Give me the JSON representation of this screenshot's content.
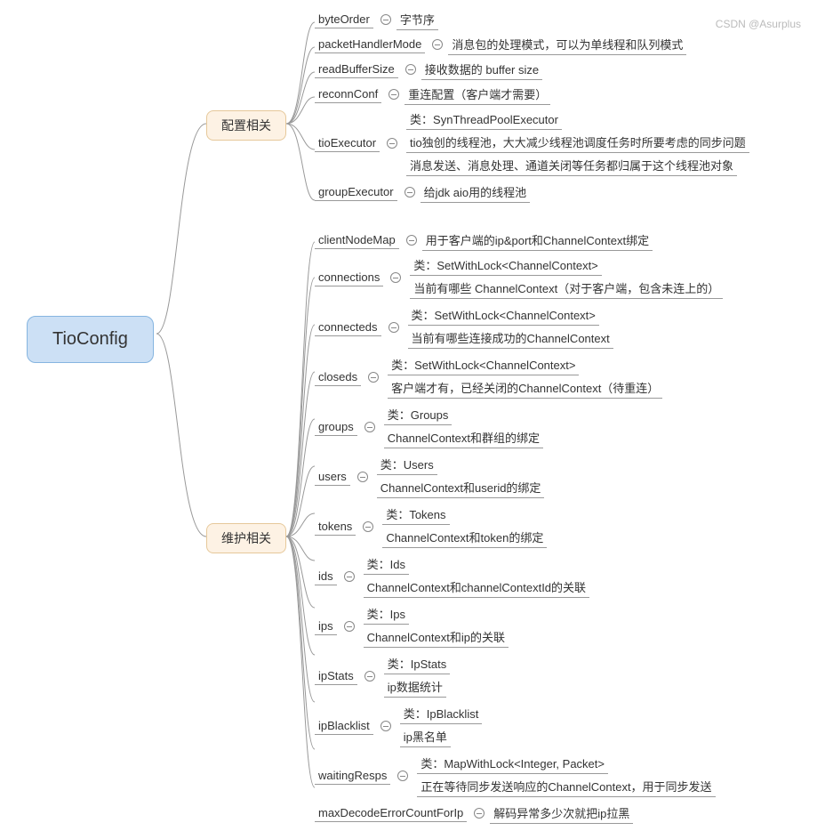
{
  "root": "TioConfig",
  "branches": [
    {
      "label": "配置相关"
    },
    {
      "label": "维护相关"
    }
  ],
  "config": {
    "byteOrder": {
      "name": "byteOrder",
      "desc": "字节序"
    },
    "packetHandlerMode": {
      "name": "packetHandlerMode",
      "desc": "消息包的处理模式，可以为单线程和队列模式"
    },
    "readBufferSize": {
      "name": "readBufferSize",
      "desc": "接收数据的 buffer size"
    },
    "reconnConf": {
      "name": "reconnConf",
      "desc": "重连配置（客户端才需要）"
    },
    "tioExecutor": {
      "name": "tioExecutor",
      "items": [
        "类：SynThreadPoolExecutor",
        "tio独创的线程池，大大减少线程池调度任务时所要考虑的同步问题",
        "消息发送、消息处理、通道关闭等任务都归属于这个线程池对象"
      ]
    },
    "groupExecutor": {
      "name": "groupExecutor",
      "desc": "给jdk aio用的线程池"
    }
  },
  "maintain": {
    "clientNodeMap": {
      "name": "clientNodeMap",
      "desc": "用于客户端的ip&port和ChannelContext绑定"
    },
    "connections": {
      "name": "connections",
      "items": [
        "类：SetWithLock<ChannelContext>",
        "当前有哪些 ChannelContext（对于客户端，包含未连上的）"
      ]
    },
    "connecteds": {
      "name": "connecteds",
      "items": [
        "类：SetWithLock<ChannelContext>",
        "当前有哪些连接成功的ChannelContext"
      ]
    },
    "closeds": {
      "name": "closeds",
      "items": [
        "类：SetWithLock<ChannelContext>",
        "客户端才有，已经关闭的ChannelContext（待重连）"
      ]
    },
    "groups": {
      "name": "groups",
      "items": [
        "类：Groups",
        "ChannelContext和群组的绑定"
      ]
    },
    "users": {
      "name": "users",
      "items": [
        "类：Users",
        "ChannelContext和userid的绑定"
      ]
    },
    "tokens": {
      "name": "tokens",
      "items": [
        "类：Tokens",
        "ChannelContext和token的绑定"
      ]
    },
    "ids": {
      "name": "ids",
      "items": [
        "类：Ids",
        "ChannelContext和channelContextId的关联"
      ]
    },
    "ips": {
      "name": "ips",
      "items": [
        "类：Ips",
        "ChannelContext和ip的关联"
      ]
    },
    "ipStats": {
      "name": "ipStats",
      "items": [
        "类：IpStats",
        "ip数据统计"
      ]
    },
    "ipBlacklist": {
      "name": "ipBlacklist",
      "items": [
        "类：IpBlacklist",
        "ip黑名单"
      ]
    },
    "waitingResps": {
      "name": "waitingResps",
      "items": [
        "类：MapWithLock<Integer, Packet>",
        "正在等待同步发送响应的ChannelContext，用于同步发送"
      ]
    },
    "maxDecodeErrorCountForIp": {
      "name": "maxDecodeErrorCountForIp",
      "desc": "解码异常多少次就把ip拉黑"
    }
  },
  "watermark": "CSDN @Asurplus"
}
